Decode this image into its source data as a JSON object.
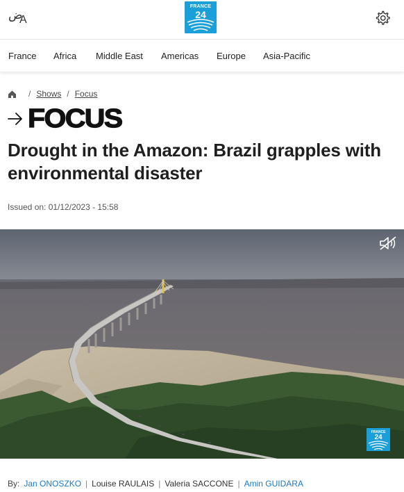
{
  "header": {
    "lang_switch_primary": "ض",
    "lang_switch_secondary": "A",
    "logo_top": "FRANCE",
    "logo_bottom": "24",
    "brand_color": "#1a9fd9"
  },
  "nav": {
    "items": [
      "France",
      "Africa",
      "Middle East",
      "Americas",
      "Europe",
      "Asia-Pacific"
    ]
  },
  "breadcrumb": {
    "items": [
      "Shows",
      "Focus"
    ],
    "separator": "/"
  },
  "show": {
    "title": "FOCUS"
  },
  "article": {
    "headline": "Drought in the Amazon: Brazil grapples with environmental disaster",
    "issued": "Issued on: 01/12/2023 - 15:58"
  },
  "video": {
    "logo_top": "FRANCE",
    "logo_bottom": "24",
    "muted": true
  },
  "byline": {
    "label": "By:",
    "authors": [
      {
        "name": "Jan ONOSZKO",
        "linked": true
      },
      {
        "name": "Louise RAULAIS",
        "linked": false
      },
      {
        "name": "Valeria SACCONE",
        "linked": false
      },
      {
        "name": "Amin GUIDARA",
        "linked": true
      }
    ],
    "link_color": "#1a7ac4"
  }
}
